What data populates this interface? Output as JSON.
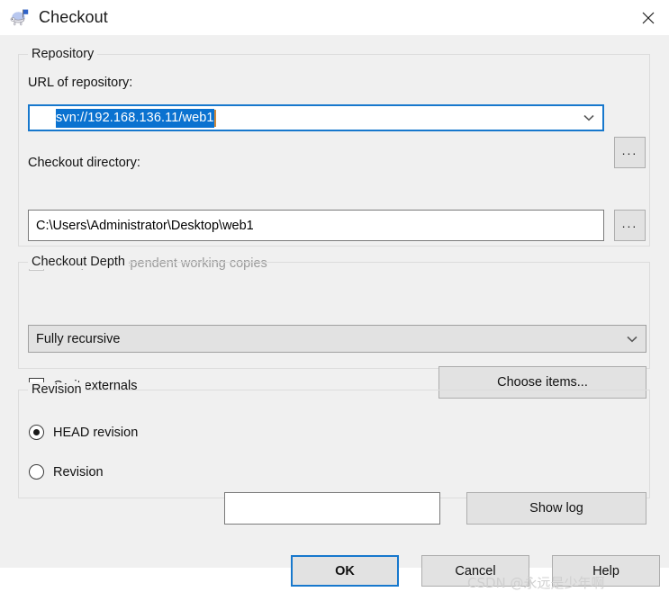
{
  "window": {
    "title": "Checkout",
    "icon": "tortoisesvn-turtle-icon",
    "close_label": "✕"
  },
  "repository": {
    "group_label": "Repository",
    "url_label": "URL of repository:",
    "url_value": "svn://192.168.136.11/web1",
    "url_selected": true,
    "browse_label": "...",
    "directory_label": "Checkout directory:",
    "directory_value": "C:\\Users\\Administrator\\Desktop\\web1",
    "multiple_checkbox_label": "Multiple, independent working copies",
    "multiple_checked": false,
    "multiple_enabled": false
  },
  "checkout_depth": {
    "group_label": "Checkout Depth",
    "selected_depth": "Fully recursive",
    "omit_externals_label": "Omit externals",
    "omit_externals_checked": false,
    "choose_items_label": "Choose items..."
  },
  "revision": {
    "group_label": "Revision",
    "head_label": "HEAD revision",
    "head_selected": true,
    "revision_label": "Revision",
    "revision_selected": false,
    "revision_value": "",
    "show_log_label": "Show log"
  },
  "footer": {
    "ok_label": "OK",
    "cancel_label": "Cancel",
    "help_label": "Help"
  },
  "watermark": {
    "text": "CSDN @永远是少年啊"
  },
  "colors": {
    "accent_blue": "#1778cd",
    "selection_blue": "#0a72d0",
    "dialog_bg": "#f0f0f0",
    "control_bg": "#e2e2e2"
  }
}
